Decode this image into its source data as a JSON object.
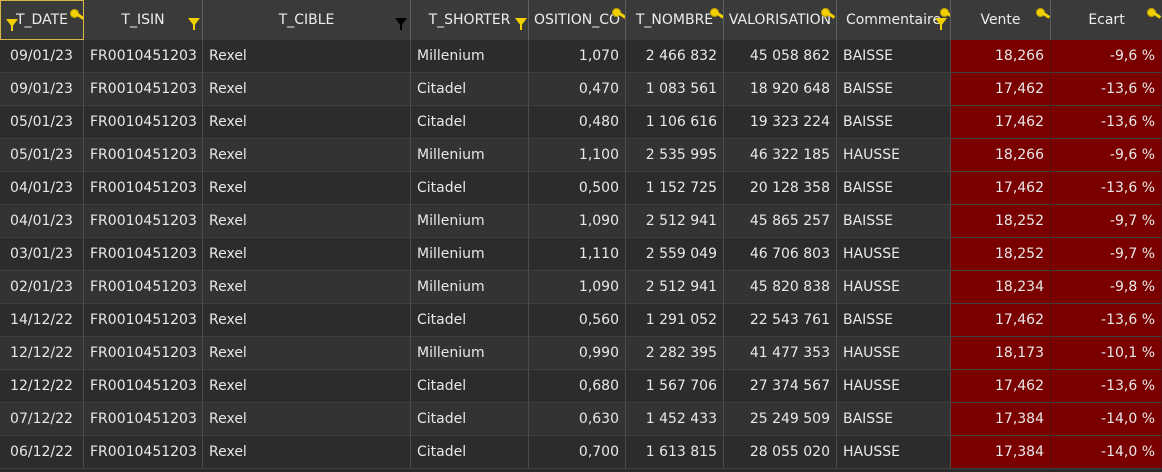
{
  "columns": [
    {
      "key": "T_DATE",
      "label": "T_DATE"
    },
    {
      "key": "T_ISIN",
      "label": "T_ISIN"
    },
    {
      "key": "T_CIBLE",
      "label": "T_CIBLE"
    },
    {
      "key": "T_SHORTER",
      "label": "T_SHORTER"
    },
    {
      "key": "POSITION",
      "label": "OSITION_CO"
    },
    {
      "key": "T_NOMBRE",
      "label": "T_NOMBRE"
    },
    {
      "key": "VALORISATION",
      "label": "VALORISATION"
    },
    {
      "key": "Commentaire",
      "label": "Commentaire"
    },
    {
      "key": "Vente",
      "label": "Vente"
    },
    {
      "key": "Ecart",
      "label": "Ecart"
    }
  ],
  "rows": [
    [
      "09/01/23",
      "FR0010451203",
      "Rexel",
      "Millenium",
      "1,070",
      "2 466 832",
      "45 058 862",
      "BAISSE",
      "18,266",
      "-9,6 %"
    ],
    [
      "09/01/23",
      "FR0010451203",
      "Rexel",
      "Citadel",
      "0,470",
      "1 083 561",
      "18 920 648",
      "BAISSE",
      "17,462",
      "-13,6 %"
    ],
    [
      "05/01/23",
      "FR0010451203",
      "Rexel",
      "Citadel",
      "0,480",
      "1 106 616",
      "19 323 224",
      "BAISSE",
      "17,462",
      "-13,6 %"
    ],
    [
      "05/01/23",
      "FR0010451203",
      "Rexel",
      "Millenium",
      "1,100",
      "2 535 995",
      "46 322 185",
      "HAUSSE",
      "18,266",
      "-9,6 %"
    ],
    [
      "04/01/23",
      "FR0010451203",
      "Rexel",
      "Citadel",
      "0,500",
      "1 152 725",
      "20 128 358",
      "BAISSE",
      "17,462",
      "-13,6 %"
    ],
    [
      "04/01/23",
      "FR0010451203",
      "Rexel",
      "Millenium",
      "1,090",
      "2 512 941",
      "45 865 257",
      "BAISSE",
      "18,252",
      "-9,7 %"
    ],
    [
      "03/01/23",
      "FR0010451203",
      "Rexel",
      "Millenium",
      "1,110",
      "2 559 049",
      "46 706 803",
      "HAUSSE",
      "18,252",
      "-9,7 %"
    ],
    [
      "02/01/23",
      "FR0010451203",
      "Rexel",
      "Millenium",
      "1,090",
      "2 512 941",
      "45 820 838",
      "HAUSSE",
      "18,234",
      "-9,8 %"
    ],
    [
      "14/12/22",
      "FR0010451203",
      "Rexel",
      "Citadel",
      "0,560",
      "1 291 052",
      "22 543 761",
      "BAISSE",
      "17,462",
      "-13,6 %"
    ],
    [
      "12/12/22",
      "FR0010451203",
      "Rexel",
      "Millenium",
      "0,990",
      "2 282 395",
      "41 477 353",
      "HAUSSE",
      "18,173",
      "-10,1 %"
    ],
    [
      "12/12/22",
      "FR0010451203",
      "Rexel",
      "Citadel",
      "0,680",
      "1 567 706",
      "27 374 567",
      "HAUSSE",
      "17,462",
      "-13,6 %"
    ],
    [
      "07/12/22",
      "FR0010451203",
      "Rexel",
      "Citadel",
      "0,630",
      "1 452 433",
      "25 249 509",
      "BAISSE",
      "17,384",
      "-14,0 %"
    ],
    [
      "06/12/22",
      "FR0010451203",
      "Rexel",
      "Citadel",
      "0,700",
      "1 613 815",
      "28 055 020",
      "HAUSSE",
      "17,384",
      "-14,0 %"
    ]
  ],
  "colors": {
    "header_bg": "#3a3a3a",
    "grid_bg": "#2b2b2b",
    "highlight_red": "#7a0000",
    "filter_icon": "#f0d000",
    "text": "#e8e8e8"
  }
}
